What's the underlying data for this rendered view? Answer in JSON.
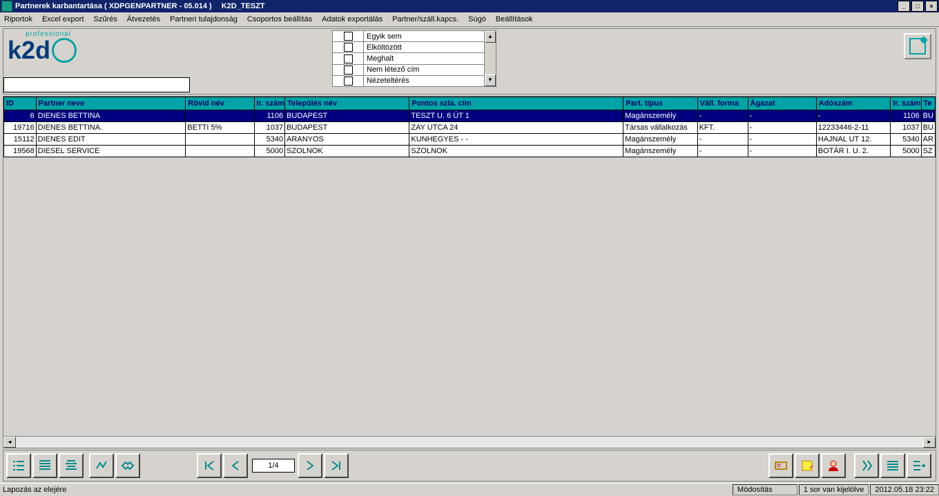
{
  "titlebar": {
    "title1": "Partnerek karbantartása ( XDPGENPARTNER - 05.014 )",
    "title2": "K2D_TESZT"
  },
  "menu": {
    "items": [
      "Riportok",
      "Excel export",
      "Szűrés",
      "Átvezetés",
      "Partneri tulajdonság",
      "Csoportos beállítás",
      "Adatok exportálás",
      "Partner/száll.kapcs.",
      "Súgó",
      "Beállítások"
    ]
  },
  "logo": {
    "small": "professional",
    "big": "k2d"
  },
  "filter_options": {
    "items": [
      "Egyik sem",
      "Elköltözött",
      "Meghalt",
      "Nem létező cím",
      "Nézeteltérés"
    ]
  },
  "grid": {
    "headers": [
      "ID",
      "Partner neve",
      "Rövid név",
      "Ir. szám",
      "Település név",
      "Pontos szla. cím",
      "Part. típus",
      "Váll. forma",
      "Ágazat",
      "Adószám",
      "Ir. szám",
      "Te"
    ],
    "rows": [
      {
        "id": "6",
        "sel": true,
        "nev": "DIENES BETTINA",
        "rovid": "",
        "ir": "1106",
        "tel": "BUDAPEST",
        "cim": "TESZT U. 6 ÚT 1",
        "tip": "Magánszemély",
        "vall": "-",
        "ag": "-",
        "ado": "-",
        "ir2": "1106",
        "te": "BU"
      },
      {
        "id": "19716",
        "nev": "DIENES BETTINA.",
        "rovid": "BETTI 5%",
        "ir": "1037",
        "tel": "BUDAPEST",
        "cim": "ZAY UTCA 24",
        "tip": "Társas vállalkozás",
        "vall": "KFT.",
        "ag": "-",
        "ado": "12233446-2-11",
        "ir2": "1037",
        "te": "BU"
      },
      {
        "id": "15112",
        "nev": "DIENES EDIT",
        "rovid": "",
        "ir": "5340",
        "tel": "ARANYOS",
        "cim": "KUNHEGYES - -",
        "tip": "Magánszemély",
        "vall": "-",
        "ag": "-",
        "ado": "HAJNAL UT 12.",
        "ir2": "5340",
        "te": "AR"
      },
      {
        "id": "19568",
        "nev": "DIESEL SERVICE",
        "rovid": "",
        "ir": "5000",
        "tel": "SZOLNOK",
        "cim": "SZOLNOK",
        "tip": "Magánszemély",
        "vall": "-",
        "ag": "-",
        "ado": "BOTÁR I. U. 2.",
        "ir2": "5000",
        "te": "SZ"
      }
    ]
  },
  "pager": {
    "value": "1/4"
  },
  "status": {
    "left": "Lapozás az elejére",
    "mode": "Módosítás",
    "sel": "1 sor van kijelölve",
    "time": "2012.05.18 23:22"
  },
  "winbtns": {
    "min": "_",
    "max": "□",
    "close": "×"
  }
}
